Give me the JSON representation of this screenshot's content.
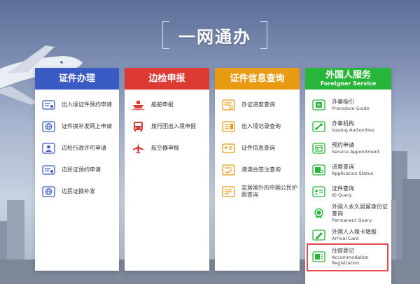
{
  "title": "一网通办",
  "colors": {
    "blue": "#3b5bc4",
    "red": "#de3a34",
    "orange": "#e89a12",
    "green": "#27b53a",
    "highlight": "#e8484a"
  },
  "cards": [
    {
      "title": "证件办理",
      "items": [
        {
          "label": "出入境证件预约申请",
          "icon": "id-card-icon"
        },
        {
          "label": "证件换补发网上申请",
          "icon": "globe-icon"
        },
        {
          "label": "边检行政许可申请",
          "icon": "person-icon"
        },
        {
          "label": "边民证预约申请",
          "icon": "id-card-icon"
        },
        {
          "label": "边民证换补发",
          "icon": "globe-icon"
        }
      ]
    },
    {
      "title": "边检申报",
      "items": [
        {
          "label": "船舶申报",
          "icon": "ship-icon"
        },
        {
          "label": "旅行团出入境申报",
          "icon": "bus-icon"
        },
        {
          "label": "航空器申报",
          "icon": "airplane-icon"
        }
      ]
    },
    {
      "title": "证件信息查询",
      "items": [
        {
          "label": "办证进度查询",
          "icon": "progress-icon"
        },
        {
          "label": "出入境记录查询",
          "icon": "record-icon"
        },
        {
          "label": "证件信息查询",
          "icon": "id-card-icon"
        },
        {
          "label": "港澳台签注查询",
          "icon": "check-doc-icon"
        },
        {
          "label": "定居国外的中国公民护照查询",
          "icon": "passport-icon"
        }
      ]
    },
    {
      "title": "外国人服务",
      "subtitle": "Foreigner Service",
      "items": [
        {
          "label": "办事指引",
          "en": "Procedure Guide",
          "icon": "guide-icon"
        },
        {
          "label": "办事机构",
          "en": "Issuing Authorities",
          "icon": "link-icon"
        },
        {
          "label": "预约申请",
          "en": "Service Appointment",
          "icon": "calendar-icon"
        },
        {
          "label": "进度查询",
          "en": "Application Status",
          "icon": "search-doc-icon"
        },
        {
          "label": "证件查询",
          "en": "ID Query",
          "icon": "id-card-icon"
        },
        {
          "label": "外国人永久居留身份证查询",
          "en": "Permanent Query",
          "icon": "badge-icon"
        },
        {
          "label": "外国人入境卡填报",
          "en": "Arrival Card",
          "icon": "edit-doc-icon"
        },
        {
          "label": "住宿登记",
          "en": "Accommodation Registration",
          "icon": "hotel-icon"
        }
      ]
    }
  ]
}
